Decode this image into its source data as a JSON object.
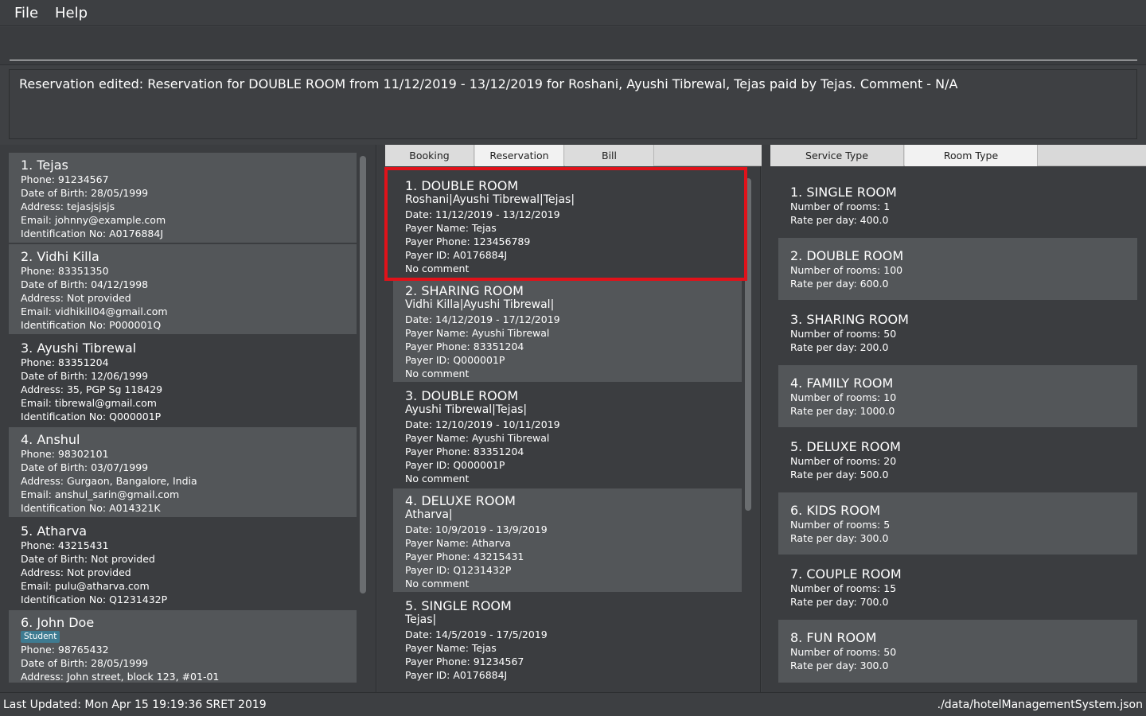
{
  "menu": {
    "file": "File",
    "help": "Help"
  },
  "command": {
    "value": "",
    "placeholder": ""
  },
  "result": {
    "message": "Reservation edited: Reservation for DOUBLE ROOM from 11/12/2019 - 13/12/2019 for Roshani, Ayushi Tibrewal, Tejas paid by Tejas. Comment - N/A"
  },
  "customers": [
    {
      "title": "1.  Tejas",
      "phone": "Phone: 91234567",
      "dob": "Date of Birth: 28/05/1999",
      "address": "Address: tejasjsjsjs",
      "email": "Email: johnny@example.com",
      "idno": "Identification No: A0176884J"
    },
    {
      "title": "2.  Vidhi Killa",
      "phone": "Phone: 83351350",
      "dob": "Date of Birth: 04/12/1998",
      "address": "Address: Not provided",
      "email": "Email: vidhikill04@gmail.com",
      "idno": "Identification No: P000001Q"
    },
    {
      "title": "3.  Ayushi Tibrewal",
      "phone": "Phone: 83351204",
      "dob": "Date of Birth: 12/06/1999",
      "address": "Address: 35, PGP Sg 118429",
      "email": "Email: tibrewal@gmail.com",
      "idno": "Identification No: Q000001P"
    },
    {
      "title": "4.  Anshul",
      "phone": "Phone: 98302101",
      "dob": "Date of Birth: 03/07/1999",
      "address": "Address: Gurgaon, Bangalore, India",
      "email": "Email: anshul_sarin@gmail.com",
      "idno": "Identification No: A014321K"
    },
    {
      "title": "5.  Atharva",
      "phone": "Phone: 43215431",
      "dob": "Date of Birth: Not provided",
      "address": "Address: Not provided",
      "email": "Email: pulu@atharva.com",
      "idno": "Identification No: Q1231432P"
    },
    {
      "title": "6.  John Doe",
      "tag": "Student",
      "phone": "Phone: 98765432",
      "dob": "Date of Birth: 28/05/1999",
      "address": "Address: John street, block 123, #01-01"
    }
  ],
  "middle_tabs": [
    {
      "label": "Booking"
    },
    {
      "label": "Reservation"
    },
    {
      "label": "Bill"
    }
  ],
  "reservations": [
    {
      "title": "1.  DOUBLE ROOM",
      "guests": "Roshani|Ayushi Tibrewal|Tejas|",
      "date": "Date: 11/12/2019 - 13/12/2019",
      "payer_name": "Payer Name: Tejas",
      "payer_phone": "Payer Phone: 123456789",
      "payer_id": "Payer ID: A0176884J",
      "comment": "No comment"
    },
    {
      "title": "2.  SHARING ROOM",
      "guests": "Vidhi Killa|Ayushi Tibrewal|",
      "date": "Date: 14/12/2019 - 17/12/2019",
      "payer_name": "Payer Name: Ayushi Tibrewal",
      "payer_phone": "Payer Phone: 83351204",
      "payer_id": "Payer ID: Q000001P",
      "comment": "No comment"
    },
    {
      "title": "3.  DOUBLE ROOM",
      "guests": "Ayushi Tibrewal|Tejas|",
      "date": "Date: 12/10/2019 - 10/11/2019",
      "payer_name": "Payer Name: Ayushi Tibrewal",
      "payer_phone": "Payer Phone: 83351204",
      "payer_id": "Payer ID: Q000001P",
      "comment": "No comment"
    },
    {
      "title": "4.  DELUXE ROOM",
      "guests": "Atharva|",
      "date": "Date: 10/9/2019 - 13/9/2019",
      "payer_name": "Payer Name: Atharva",
      "payer_phone": "Payer Phone: 43215431",
      "payer_id": "Payer ID: Q1231432P",
      "comment": "No comment"
    },
    {
      "title": "5.  SINGLE ROOM",
      "guests": "Tejas|",
      "date": "Date: 14/5/2019 - 17/5/2019",
      "payer_name": "Payer Name: Tejas",
      "payer_phone": "Payer Phone: 91234567",
      "payer_id": "Payer ID: A0176884J"
    }
  ],
  "right_tabs": [
    {
      "label": "Service Type"
    },
    {
      "label": "Room Type"
    }
  ],
  "rooms": [
    {
      "title": "1.  SINGLE ROOM",
      "count": "Number of rooms: 1",
      "rate": "Rate per day: 400.0"
    },
    {
      "title": "2.  DOUBLE ROOM",
      "count": "Number of rooms: 100",
      "rate": "Rate per day: 600.0"
    },
    {
      "title": "3.  SHARING ROOM",
      "count": "Number of rooms: 50",
      "rate": "Rate per day: 200.0"
    },
    {
      "title": "4.  FAMILY ROOM",
      "count": "Number of rooms: 10",
      "rate": "Rate per day: 1000.0"
    },
    {
      "title": "5.  DELUXE ROOM",
      "count": "Number of rooms: 20",
      "rate": "Rate per day: 500.0"
    },
    {
      "title": "6.  KIDS ROOM",
      "count": "Number of rooms: 5",
      "rate": "Rate per day: 300.0"
    },
    {
      "title": "7.  COUPLE ROOM",
      "count": "Number of rooms: 15",
      "rate": "Rate per day: 700.0"
    },
    {
      "title": "8.  FUN ROOM",
      "count": "Number of rooms: 50",
      "rate": "Rate per day: 300.0"
    }
  ],
  "status": {
    "last_updated": "Last Updated: Mon Apr 15 19:19:36 SRET 2019",
    "file_path": "./data/hotelManagementSystem.json"
  }
}
